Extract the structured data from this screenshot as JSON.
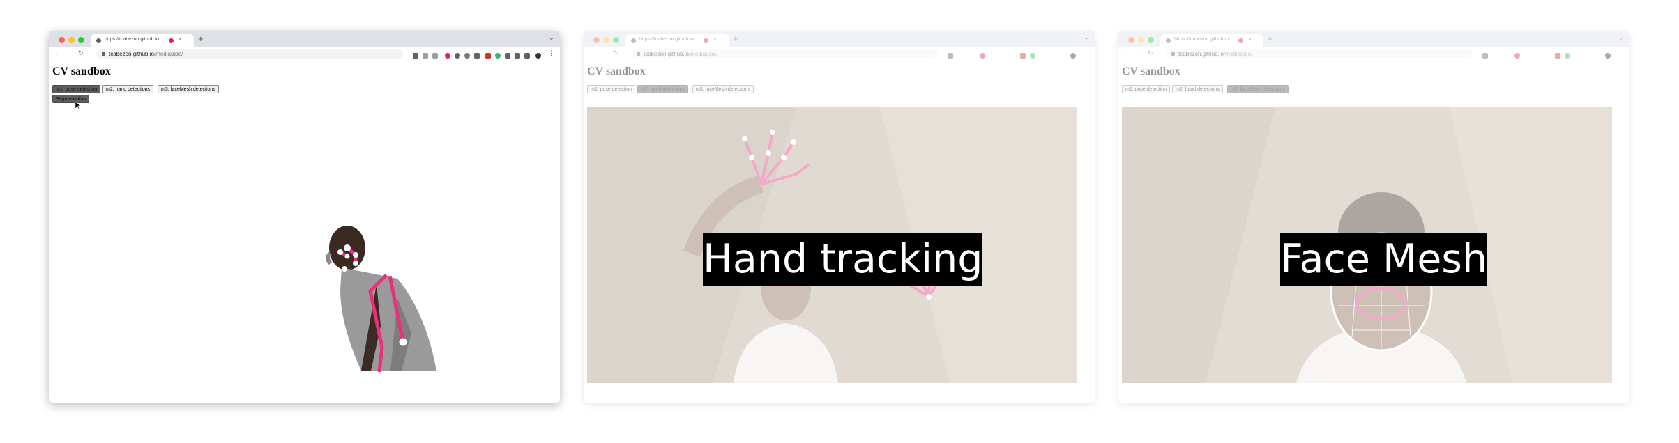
{
  "browser": {
    "tab_title": "https://tcabezon.github.io",
    "tab_close": "×",
    "new_tab": "+",
    "tab_list": "⌄",
    "nav": {
      "back": "←",
      "forward": "→",
      "reload": "↻"
    },
    "url_host": "tcabezon.github.io",
    "url_path": "/mediapipe/"
  },
  "page": {
    "heading": "CV sandbox",
    "buttons": {
      "pose": "m1: pose detection",
      "hands": "m2: hand detections",
      "facemesh": "m3: faceMesh detections"
    },
    "tooltip": "Segmentation"
  },
  "panels": {
    "hand_caption": "Hand tracking",
    "face_caption": "Face Mesh"
  },
  "colors": {
    "landmark_pink": "#e8317c",
    "landmark_white": "#ffffff",
    "traffic": [
      "#fe5f57",
      "#febc2e",
      "#28c840"
    ]
  }
}
